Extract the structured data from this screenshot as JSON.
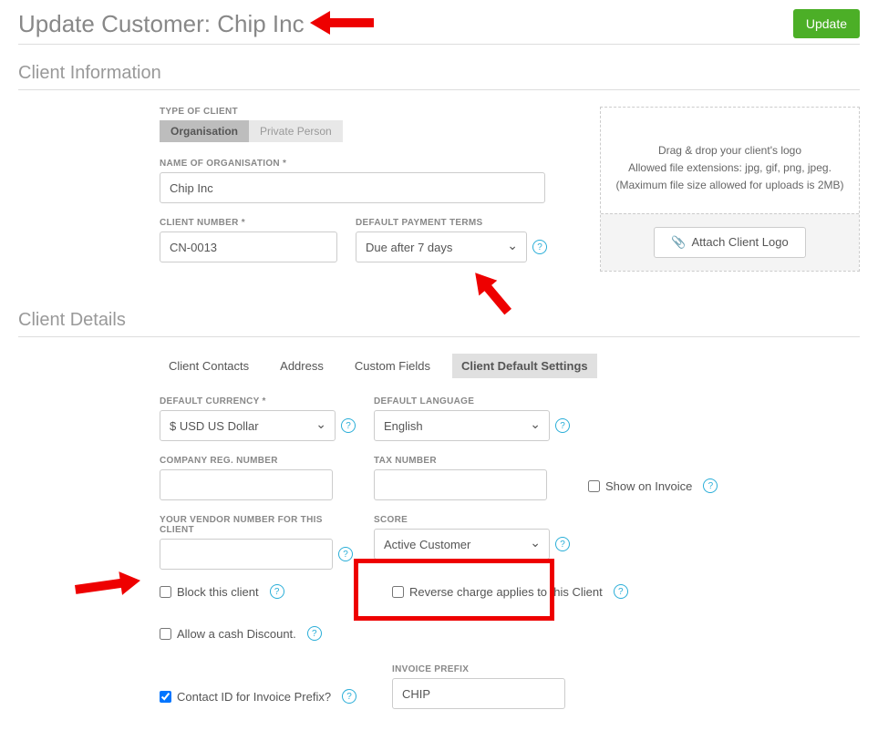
{
  "header": {
    "title": "Update Customer: Chip Inc",
    "update_label": "Update"
  },
  "client_info": {
    "section_title": "Client Information",
    "type_label": "TYPE OF CLIENT",
    "type_options": {
      "organisation": "Organisation",
      "private": "Private Person"
    },
    "name_label": "NAME OF ORGANISATION *",
    "name_value": "Chip Inc",
    "client_number_label": "CLIENT NUMBER *",
    "client_number_value": "CN-0013",
    "payment_terms_label": "DEFAULT PAYMENT TERMS",
    "payment_terms_value": "Due after 7 days",
    "logo_drop_line1": "Drag & drop your client's logo",
    "logo_drop_line2": "Allowed file extensions: jpg, gif, png, jpeg.",
    "logo_drop_line3": "(Maximum file size allowed for uploads is 2MB)",
    "attach_label": "Attach Client Logo"
  },
  "client_details": {
    "section_title": "Client Details",
    "tabs": {
      "contacts": "Client Contacts",
      "address": "Address",
      "custom": "Custom Fields",
      "defaults": "Client Default Settings"
    },
    "currency_label": "DEFAULT CURRENCY *",
    "currency_value": "$ USD US Dollar",
    "language_label": "DEFAULT LANGUAGE",
    "language_value": "English",
    "company_reg_label": "COMPANY REG. NUMBER",
    "company_reg_value": "",
    "tax_number_label": "TAX NUMBER",
    "tax_number_value": "",
    "show_on_invoice_label": "Show on Invoice",
    "vendor_label": "YOUR VENDOR NUMBER FOR THIS CLIENT",
    "vendor_value": "",
    "score_label": "SCORE",
    "score_value": "Active Customer",
    "block_label": "Block this client",
    "reverse_label": "Reverse charge applies to this Client",
    "cash_discount_label": "Allow a cash Discount.",
    "contact_id_label": "Contact ID for Invoice Prefix?",
    "invoice_prefix_label": "INVOICE PREFIX",
    "invoice_prefix_value": "CHIP"
  }
}
